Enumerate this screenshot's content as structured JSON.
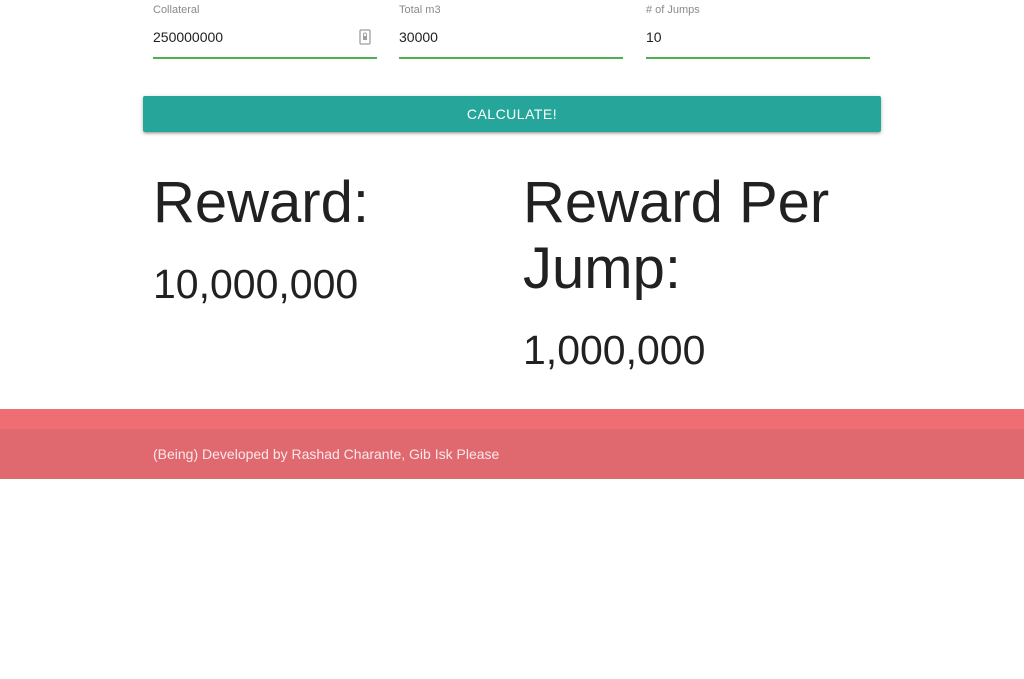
{
  "form": {
    "collateral": {
      "label": "Collateral",
      "value": "250000000"
    },
    "total_m3": {
      "label": "Total m3",
      "value": "30000"
    },
    "jumps": {
      "label": "# of Jumps",
      "value": "10"
    }
  },
  "button": {
    "label": "CALCULATE!"
  },
  "results": {
    "reward": {
      "heading": "Reward:",
      "value": "10,000,000"
    },
    "reward_per_jump": {
      "heading_line1": "Reward Per",
      "heading_line2": "Jump:",
      "value": "1,000,000"
    }
  },
  "footer": {
    "text": "(Being) Developed by Rashad Charante, Gib Isk Please"
  },
  "colors": {
    "accent": "#26a69a",
    "input_underline": "#4caf50",
    "footer": "#e57373"
  }
}
